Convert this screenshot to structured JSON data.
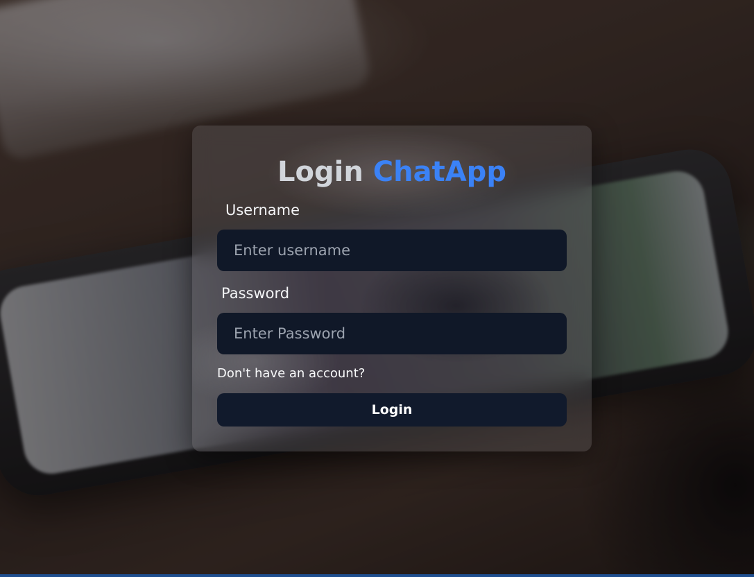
{
  "login_form": {
    "title_prefix": "Login",
    "title_brand": "ChatApp",
    "username_label": "Username",
    "username_placeholder": "Enter username",
    "password_label": "Password",
    "password_placeholder": "Enter Password",
    "signup_link": "Don't have an account?",
    "login_button": "Login"
  },
  "colors": {
    "brand_accent": "#3b82f6",
    "input_background": "#101828",
    "button_background": "#111a2c"
  }
}
